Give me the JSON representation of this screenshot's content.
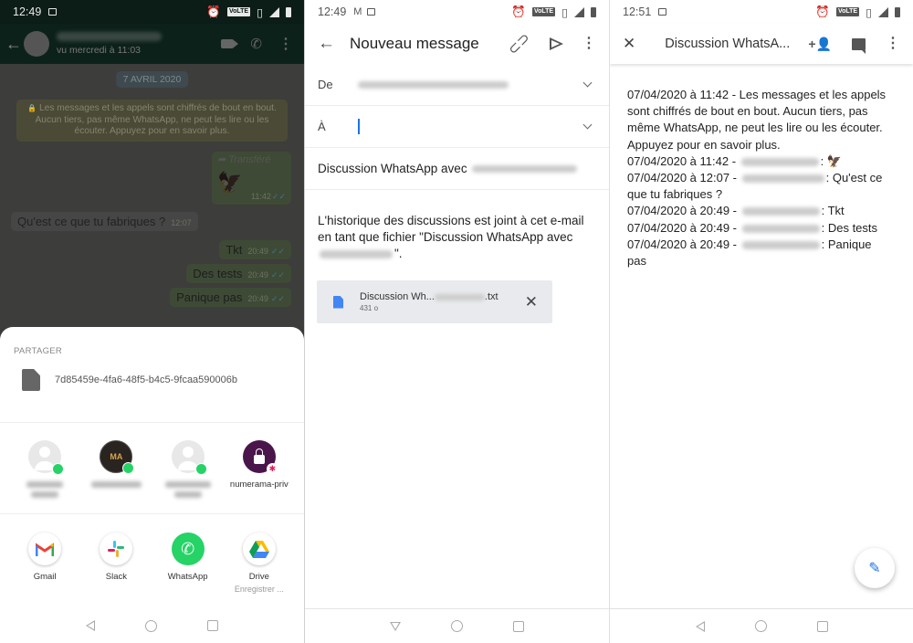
{
  "whatsapp": {
    "status_time": "12:49",
    "contact_name": "[blurred]",
    "last_seen": "vu mercredi à 11:03",
    "date_chip": "7 AVRIL 2020",
    "encryption_notice": "Les messages et les appels sont chiffrés de bout en bout. Aucun tiers, pas même WhatsApp, ne peut les lire ou les écouter. Appuyez pour en savoir plus.",
    "messages": [
      {
        "direction": "out",
        "forwarded_label": "Transféré",
        "content": "eagle-sticker",
        "time": "11:42",
        "ticks": "✓✓"
      },
      {
        "direction": "in",
        "text": "Qu'est ce que tu fabriques ?",
        "time": "12:07"
      },
      {
        "direction": "out",
        "text": "Tkt",
        "time": "20:49",
        "ticks": "✓✓"
      },
      {
        "direction": "out",
        "text": "Des tests",
        "time": "20:49",
        "ticks": "✓✓"
      },
      {
        "direction": "out",
        "text": "Panique pas",
        "time": "20:49",
        "ticks": "✓✓"
      }
    ],
    "share": {
      "title": "PARTAGER",
      "file_name": "7d85459e-4fa6-48f5-b4c5-9fcaa590006b",
      "targets": [
        {
          "label": "[blurred]",
          "type": "contact",
          "badge": "whatsapp"
        },
        {
          "label": "[blurred]",
          "type": "group",
          "avatar_text": "MA",
          "badge": "whatsapp"
        },
        {
          "label": "[blurred]",
          "type": "contact",
          "badge": "whatsapp"
        },
        {
          "label": "numerama-priv",
          "type": "channel",
          "badge": "slack"
        }
      ],
      "apps": [
        {
          "label": "Gmail",
          "icon": "gmail-icon"
        },
        {
          "label": "Slack",
          "icon": "slack-icon"
        },
        {
          "label": "WhatsApp",
          "icon": "whatsapp-icon",
          "glyph": "✆"
        },
        {
          "label": "Drive",
          "sub": "Enregistrer ...",
          "icon": "drive-icon"
        }
      ]
    }
  },
  "gmail": {
    "status_time": "12:49",
    "title": "Nouveau message",
    "from_label": "De",
    "from_value": "[blurred email]",
    "to_label": "À",
    "to_value": "",
    "subject_prefix": "Discussion WhatsApp avec",
    "body_part1": "L'historique des discussions est joint à cet e-mail en tant que fichier \"Discussion WhatsApp avec",
    "body_part2": "\".",
    "attachment": {
      "name_prefix": "Discussion Wh...",
      "name_suffix": ".txt",
      "size": "431 o"
    }
  },
  "viewer": {
    "status_time": "12:51",
    "title": "Discussion WhatsA...",
    "lines": [
      {
        "prefix": "07/04/2020 à 11:42 - Les messages et les appels sont chiffrés de bout en bout. Aucun tiers, pas même WhatsApp, ne peut les lire ou les écouter. Appuyez pour en savoir plus.",
        "blur": false,
        "suffix": ""
      },
      {
        "prefix": "07/04/2020 à 11:42 - ",
        "blur": true,
        "suffix": ": 🦅"
      },
      {
        "prefix": "07/04/2020 à 12:07 - ",
        "blur": true,
        "suffix": ": Qu'est ce que tu fabriques ?"
      },
      {
        "prefix": "07/04/2020 à 20:49 - ",
        "blur": true,
        "suffix": ": Tkt"
      },
      {
        "prefix": "07/04/2020 à 20:49 - ",
        "blur": true,
        "suffix": ": Des tests"
      },
      {
        "prefix": "07/04/2020 à 20:49 - ",
        "blur": true,
        "suffix": ": Panique pas"
      }
    ]
  },
  "status_icons": {
    "volte": "VoLTE",
    "network": "4G"
  },
  "icons": {
    "back": "←",
    "close": "✕",
    "more": "⋮",
    "pencil": "✎",
    "phone": "✆",
    "clip": "📎",
    "forward": "➦",
    "eagle": "🦅",
    "lock": "🔒",
    "add_person": "+👤"
  }
}
